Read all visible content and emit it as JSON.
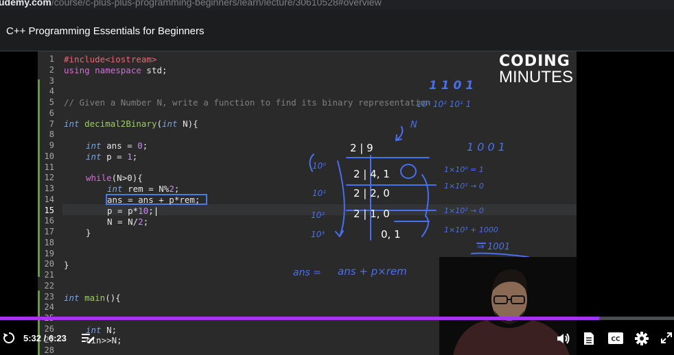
{
  "browser": {
    "url_host": "udemy.com",
    "url_path": "/course/c-plus-plus-programming-beginners/learn/lecture/30610528#overview"
  },
  "header": {
    "title": "C++ Programming Essentials for Beginners"
  },
  "slide": {
    "line_numbers": [
      "1",
      "2",
      "3",
      "4",
      "5",
      "6",
      "7",
      "8",
      "9",
      "10",
      "11",
      "12",
      "13",
      "14",
      "15",
      "16",
      "17",
      "18",
      "19",
      "20",
      "21",
      "22",
      "23",
      "24",
      "25",
      "26",
      "27",
      "28"
    ],
    "current_line": "15",
    "logo_line1": "CODING",
    "logo_line2": "MINUTES",
    "code": {
      "l1_include": "#include<iostream>",
      "l2_using": "using namespace",
      "l2_std": " std;",
      "l5_comment": "// Given a Number N, write a function to find its binary representation",
      "l7_type": "int",
      "l7_name": "decimal2Binary",
      "l7_open": "(",
      "l7_ptype": "int",
      "l7_rest": " N){",
      "l9_type": "int",
      "l9_rest": " ans = ",
      "l9_num": "0",
      "l9_end": ";",
      "l10_type": "int",
      "l10_rest": " p = ",
      "l10_num": "1",
      "l10_end": ";",
      "l12_kw": "while",
      "l12_rest": "(N>0){",
      "l13_type": "int",
      "l13_rest": " rem = N%",
      "l13_num": "2",
      "l13_end": ";",
      "l14_text": "ans = ans + p*rem;",
      "l15_text": "p = p*",
      "l15_num": "10",
      "l15_end": ";",
      "l16_text": "N = N/",
      "l16_num": "2",
      "l16_end": ";",
      "l17_text": "}",
      "l20_text": "}",
      "l23_type": "int",
      "l23_name": "main",
      "l23_rest": "(){",
      "l26_type": "int",
      "l26_rest": " N;",
      "l27_text": "cin>>N;"
    },
    "handwriting": {
      "binary_top": "1 1 0 1",
      "powers_top": "10³ 10² 10¹ 1",
      "n_label": "N",
      "div_rows": [
        "2 | 9",
        "2 | 4, 1",
        "2 | 2, 0",
        "2 | 1, 0",
        "0, 1"
      ],
      "powers_left": [
        "10⁰",
        "10¹",
        "10²",
        "10³"
      ],
      "mult_rows": [
        "1×10⁰ = 1",
        "1×10¹ → 0",
        "1×10² → 0",
        "1×10³ + 1000"
      ],
      "binary_right": "1 0 0 1",
      "result": "⇒ 1001",
      "formula_left": "ans =",
      "formula_right": "ans + p×rem"
    }
  },
  "player": {
    "time": "5:32 / 6:23",
    "progress_fraction": 0.889
  }
}
